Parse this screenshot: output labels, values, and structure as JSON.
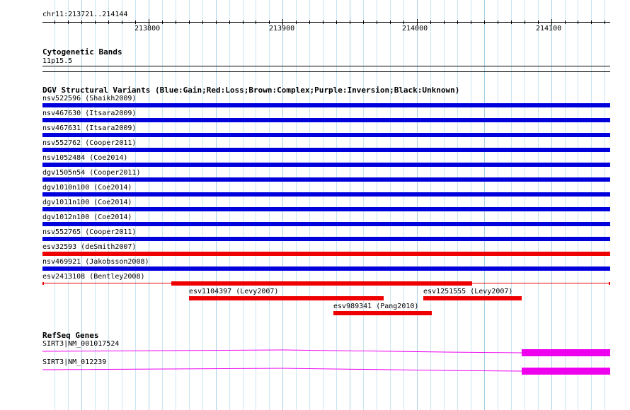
{
  "ruler": {
    "region": "chr11:213721..214144",
    "start": 213721,
    "end": 214144,
    "labels": [
      "213800",
      "213900",
      "214000",
      "214100"
    ]
  },
  "cytobands": {
    "title": "Cytogenetic Bands",
    "band": "11p15.5"
  },
  "dgv": {
    "title": "DGV Structural Variants (Blue:Gain;Red:Loss;Brown:Complex;Purple:Inversion;Black:Unknown)",
    "colors": {
      "gain": "#0000dd",
      "loss": "#ee0000"
    },
    "variants": [
      {
        "label": "nsv522596 (Shaikh2009)",
        "type": "gain",
        "start": 213721,
        "end": 214144
      },
      {
        "label": "nsv467630 (Itsara2009)",
        "type": "gain",
        "start": 213721,
        "end": 214144
      },
      {
        "label": "nsv467631 (Itsara2009)",
        "type": "gain",
        "start": 213721,
        "end": 214144
      },
      {
        "label": "nsv552762 (Cooper2011)",
        "type": "gain",
        "start": 213721,
        "end": 214144
      },
      {
        "label": "nsv1052484 (Coe2014)",
        "type": "gain",
        "start": 213721,
        "end": 214144
      },
      {
        "label": "dgv1505n54 (Cooper2011)",
        "type": "gain",
        "start": 213721,
        "end": 214144
      },
      {
        "label": "dgv1010n100 (Coe2014)",
        "type": "gain",
        "start": 213721,
        "end": 214144
      },
      {
        "label": "dgv1011n100 (Coe2014)",
        "type": "gain",
        "start": 213721,
        "end": 214144
      },
      {
        "label": "dgv1012n100 (Coe2014)",
        "type": "gain",
        "start": 213721,
        "end": 214144
      },
      {
        "label": "nsv552765 (Cooper2011)",
        "type": "gain",
        "start": 213721,
        "end": 214144
      },
      {
        "label": "esv32593 (deSmith2007)",
        "type": "loss",
        "start": 213721,
        "end": 214144
      },
      {
        "label": "nsv469921 (Jakobsson2008)",
        "type": "gain",
        "start": 213721,
        "end": 214144
      },
      {
        "label": "esv2413108 (Bentley2008)",
        "type": "loss",
        "start": 213817,
        "end": 214041
      }
    ],
    "extra": [
      {
        "label": "esv1104397 (Levy2007)",
        "type": "loss",
        "start": 213830,
        "end": 213975
      },
      {
        "label": "esv1251555 (Levy2007)",
        "type": "loss",
        "start": 214005,
        "end": 214078
      },
      {
        "label": "esv989341 (Pang2010)",
        "type": "loss",
        "start": 213938,
        "end": 214011
      }
    ]
  },
  "refseq": {
    "title": "RefSeq Genes",
    "color": "#ee00ee",
    "genes": [
      {
        "label": "SIRT3|NM_001017524",
        "exon_start": 214078,
        "exon_end": 214144
      },
      {
        "label": "SIRT3|NM_012239",
        "exon_start": 214078,
        "exon_end": 214144
      }
    ]
  }
}
